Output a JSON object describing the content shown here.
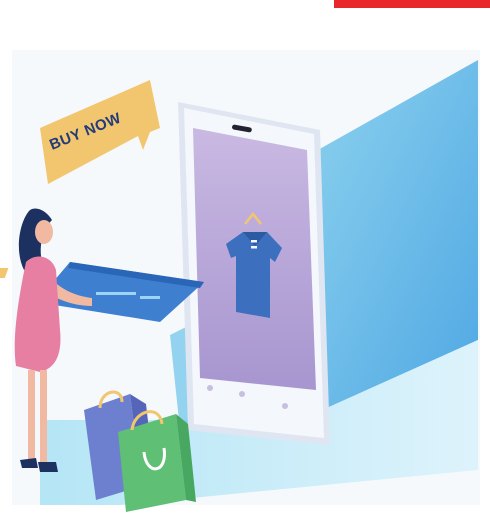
{
  "image": {
    "description": "",
    "speech_bubble": {
      "text": "BUY NOW"
    }
  },
  "colors": {
    "accent_red": "#e8262b",
    "phone_screen": "#b7a5d6",
    "shirt": "#3d6fbf",
    "card": "#3f7fd0",
    "bubble": "#f2c66e",
    "dress": "#e77fa3",
    "bag_blue": "#6d7fcf",
    "bag_green": "#5fbf75"
  },
  "icons": [
    "shirt-on-hanger-icon"
  ]
}
